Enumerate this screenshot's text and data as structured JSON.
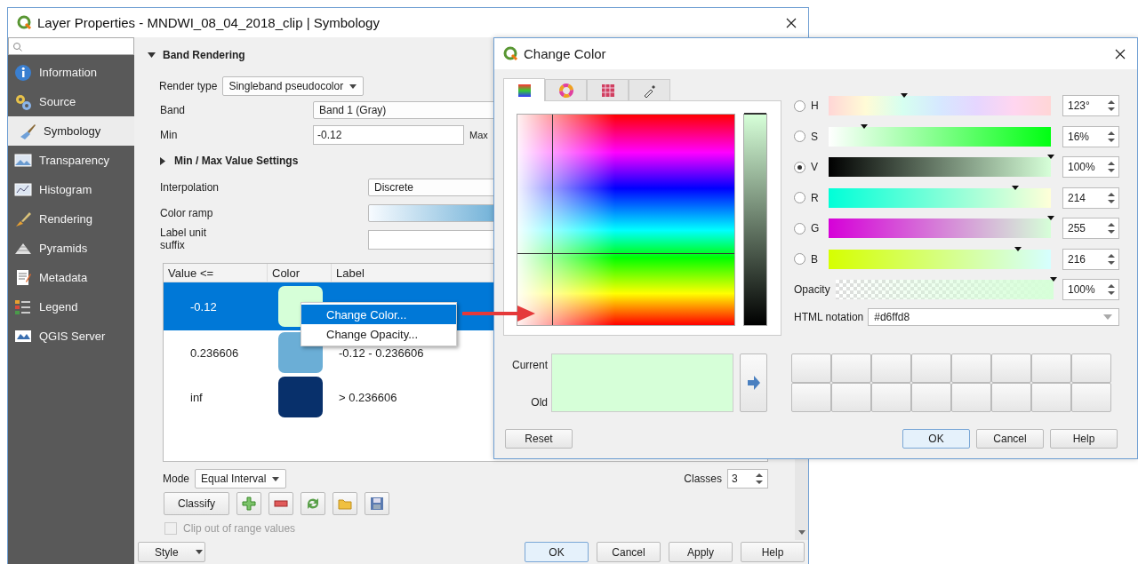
{
  "window": {
    "title": "Layer Properties - MNDWI_08_04_2018_clip | Symbology"
  },
  "sidebar": {
    "items": [
      {
        "label": "Information",
        "selected": false
      },
      {
        "label": "Source",
        "selected": false
      },
      {
        "label": "Symbology",
        "selected": true
      },
      {
        "label": "Transparency",
        "selected": false
      },
      {
        "label": "Histogram",
        "selected": false
      },
      {
        "label": "Rendering",
        "selected": false
      },
      {
        "label": "Pyramids",
        "selected": false
      },
      {
        "label": "Metadata",
        "selected": false
      },
      {
        "label": "Legend",
        "selected": false
      },
      {
        "label": "QGIS Server",
        "selected": false
      }
    ]
  },
  "band_rendering": {
    "title": "Band Rendering",
    "expanded": true,
    "render_type_label": "Render type",
    "render_type": "Singleband pseudocolor",
    "band_label": "Band",
    "band": "Band 1 (Gray)",
    "min_label": "Min",
    "min": "-0.12",
    "max_label": "Max",
    "minmax_settings": {
      "title": "Min / Max Value Settings",
      "expanded": false
    },
    "interpolation_label": "Interpolation",
    "interpolation": "Discrete",
    "color_ramp_label": "Color ramp",
    "label_unit_label": "Label unit suffix"
  },
  "table": {
    "columns": [
      "Value <=",
      "Color",
      "Label"
    ],
    "rows": [
      {
        "value": "-0.12",
        "color": "#d6ffd8",
        "selected": true
      },
      {
        "value": "0.236606",
        "color": "#6baed6",
        "label": "-0.12 - 0.236606",
        "selected": false
      },
      {
        "value": "inf",
        "color": "#08306b",
        "label": "> 0.236606",
        "selected": false
      }
    ]
  },
  "classification": {
    "mode_label": "Mode",
    "mode": "Equal Interval",
    "classes_label": "Classes",
    "classes": "3",
    "classify_button": "Classify"
  },
  "clip_option": {
    "label": "Clip out of range values",
    "checked": false,
    "disabled": true
  },
  "footer": {
    "style_button": "Style",
    "buttons": [
      "OK",
      "Cancel",
      "Apply",
      "Help"
    ]
  },
  "context_menu": {
    "items": [
      {
        "label": "Change Color...",
        "selected": true
      },
      {
        "label": "Change Opacity...",
        "selected": false
      }
    ]
  },
  "color_dialog": {
    "title": "Change Color",
    "tabs": [
      {
        "selected": true
      },
      {
        "selected": false
      },
      {
        "selected": false
      },
      {
        "selected": false
      }
    ],
    "channels": [
      {
        "name": "H",
        "selected": false,
        "level": 0.34,
        "reading": "123°"
      },
      {
        "name": "S",
        "selected": false,
        "level": 0.16,
        "reading": "16%"
      },
      {
        "name": "V",
        "selected": true,
        "level": 1,
        "reading": "100%"
      },
      {
        "name": "R",
        "selected": false,
        "level": 0.84,
        "reading": "214"
      },
      {
        "name": "G",
        "selected": false,
        "level": 1,
        "reading": "255"
      },
      {
        "name": "B",
        "selected": false,
        "level": 0.85,
        "reading": "216"
      }
    ],
    "opacity": {
      "label": "Opacity",
      "level": 1,
      "reading": "100%"
    },
    "html_notation": {
      "label": "HTML notation",
      "value": "#d6ffd8"
    },
    "current_label": "Current",
    "old_label": "Old",
    "reset_button": "Reset",
    "buttons": [
      "OK",
      "Cancel",
      "Help"
    ]
  }
}
